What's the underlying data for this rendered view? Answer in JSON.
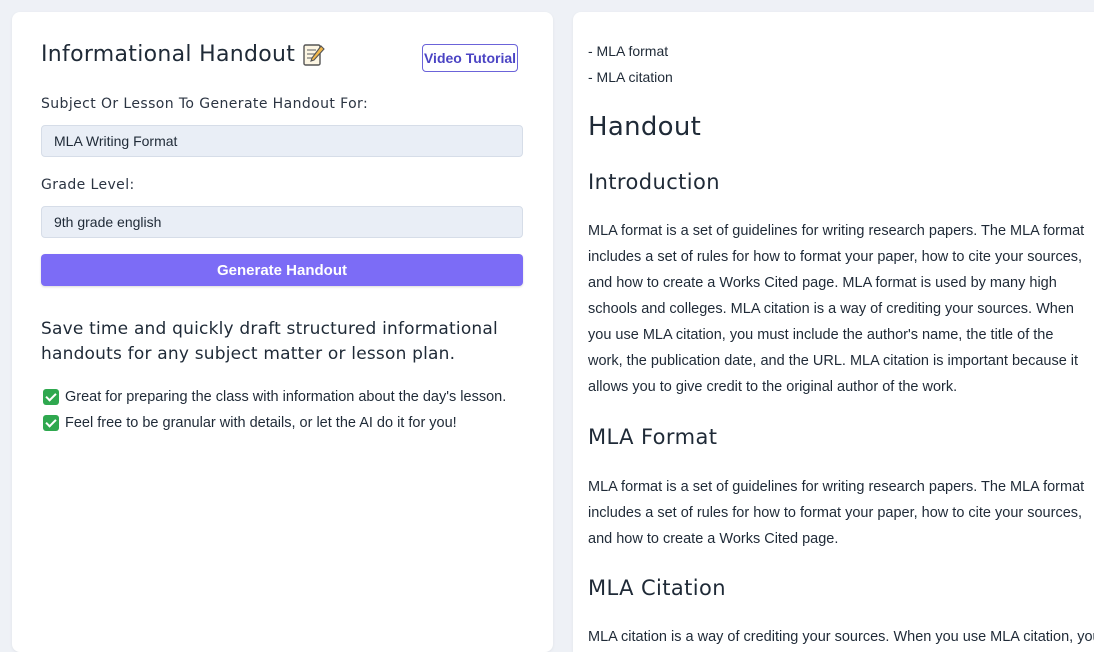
{
  "form": {
    "title": "Informational Handout",
    "video_button": "Video Tutorial",
    "subject_label": "Subject Or Lesson To Generate Handout For:",
    "subject_value": "MLA Writing Format",
    "grade_label": "Grade Level:",
    "grade_value": "9th grade english",
    "generate_button": "Generate Handout",
    "description": "Save time and quickly draft structured informational handouts for any subject matter or lesson plan.",
    "features": [
      "Great for preparing the class with information about the day's lesson.",
      "Feel free to be granular with details, or let the AI do it for you!"
    ],
    "accent_color": "#7c6cf6"
  },
  "output": {
    "bullets": [
      "- MLA format",
      "- MLA citation"
    ],
    "heading": "Handout",
    "sections": [
      {
        "title": "Introduction",
        "body": "MLA format is a set of guidelines for writing research papers. The MLA format includes a set of rules for how to format your paper, how to cite your sources, and how to create a Works Cited page. MLA format is used by many high schools and colleges. MLA citation is a way of crediting your sources. When you use MLA citation, you must include the author's name, the title of the work, the publication date, and the URL. MLA citation is important because it allows you to give credit to the original author of the work."
      },
      {
        "title": "MLA Format",
        "body": "MLA format is a set of guidelines for writing research papers. The MLA format includes a set of rules for how to format your paper, how to cite your sources, and how to create a Works Cited page."
      },
      {
        "title": "MLA Citation",
        "body": "MLA citation is a way of crediting your sources. When you use MLA citation, you"
      }
    ]
  }
}
